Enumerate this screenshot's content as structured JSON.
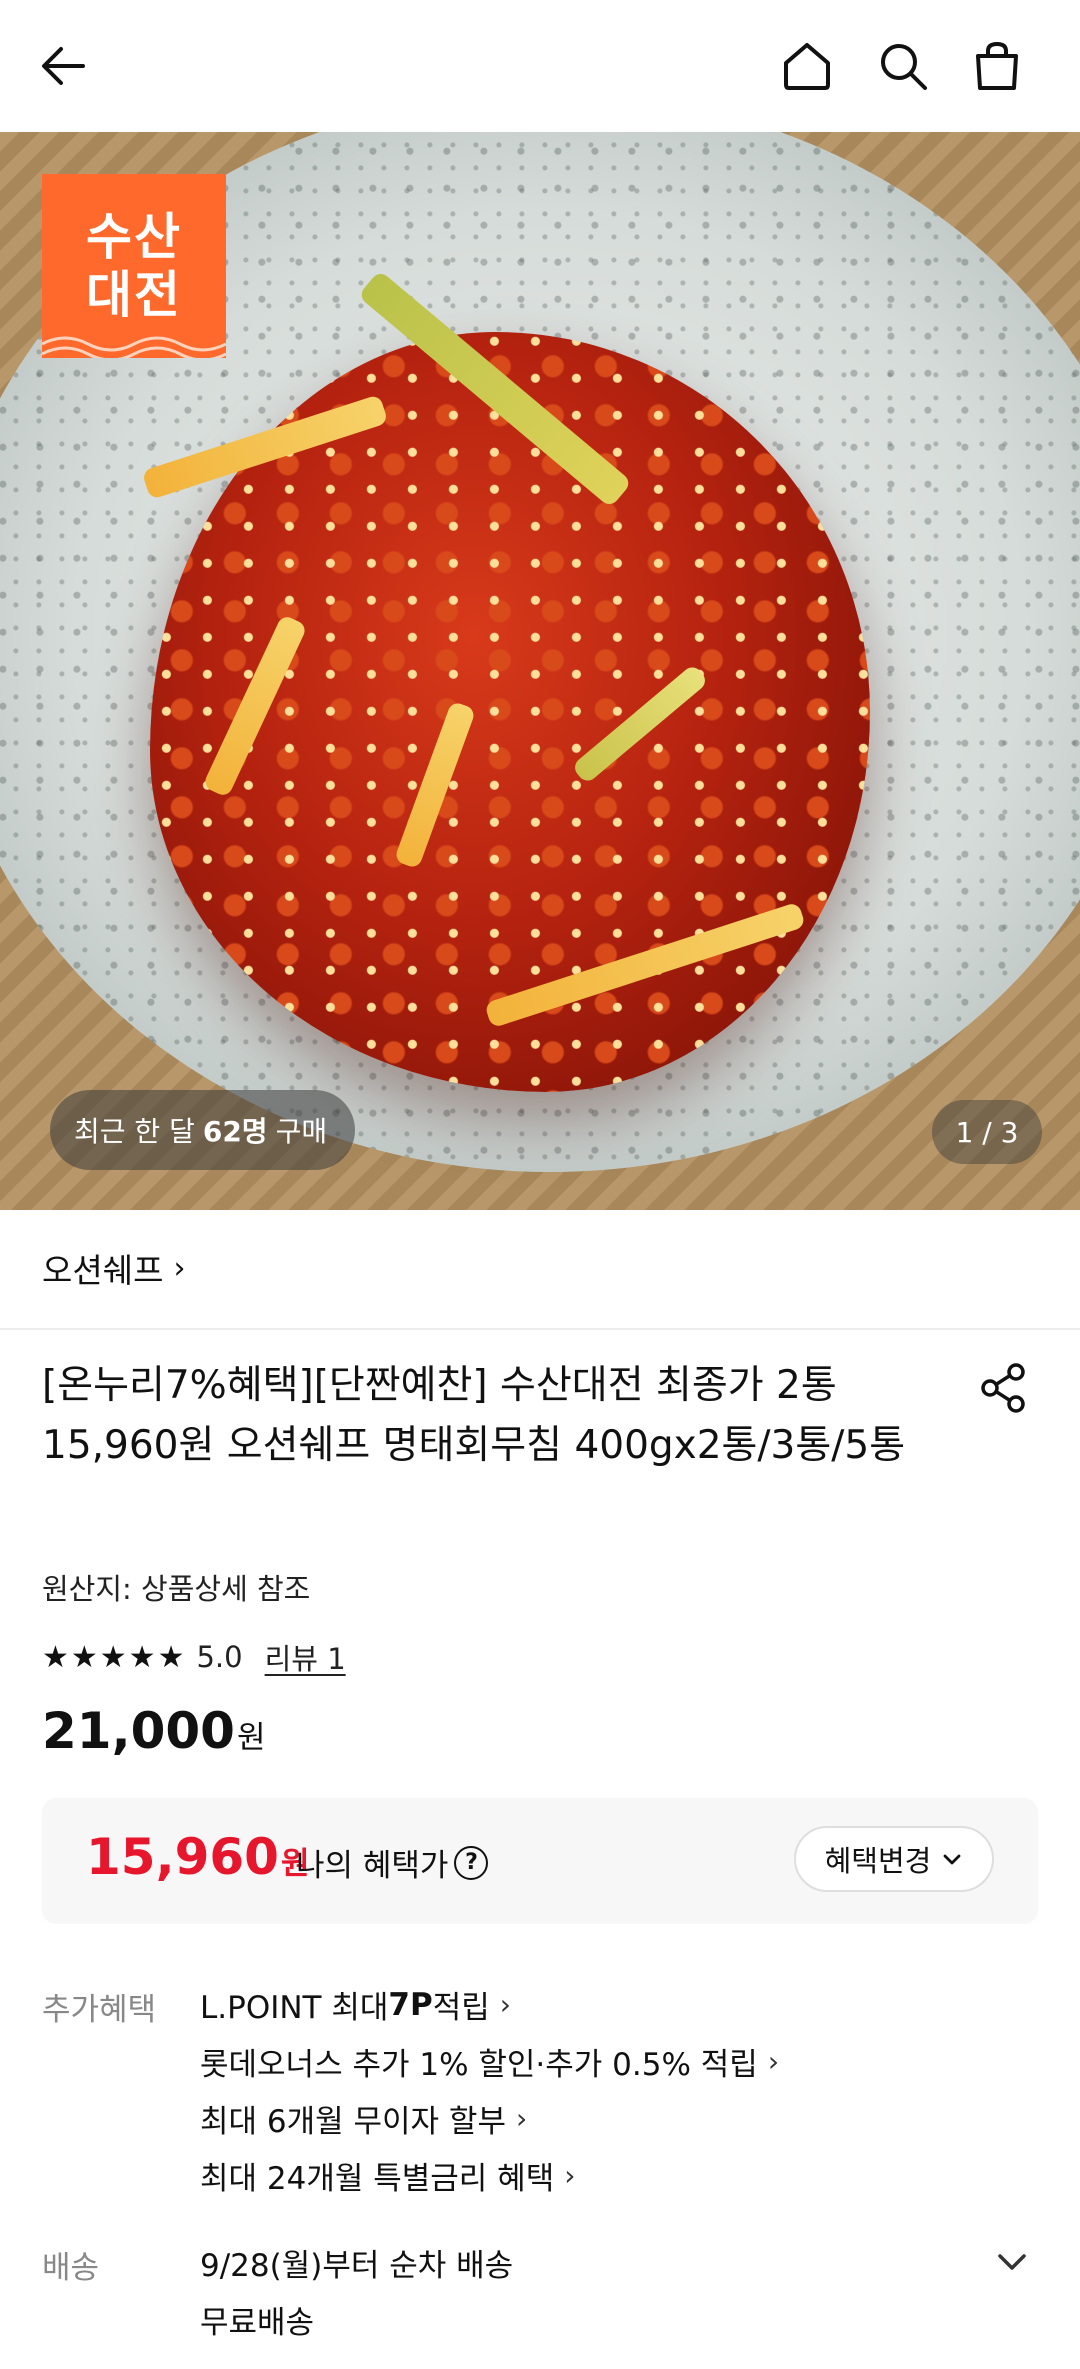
{
  "header": {
    "back_icon": "arrow-left-icon",
    "home_icon": "home-icon",
    "search_icon": "search-icon",
    "bag_icon": "shopping-bag-icon"
  },
  "hero": {
    "badge_line1": "수산",
    "badge_line2": "대전",
    "purchase_prefix": "최근 한 달",
    "purchase_count": "62명",
    "purchase_suffix": "구매",
    "image_counter": "1 / 3"
  },
  "seller": {
    "name": "오션쉐프",
    "chevron": "›"
  },
  "product": {
    "title": "[온누리7%혜택][단짠예찬] 수산대전 최종가 2통 15,960원 오션쉐프 명태회무침 400gx2통/3통/5통",
    "origin": "원산지: 상품상세 참조",
    "stars": "★★★★★",
    "rating": "5.0",
    "review_link": "리뷰 1",
    "price": "21,000",
    "price_unit": "원"
  },
  "benefit": {
    "price": "15,960",
    "price_unit": "원",
    "label": "나의 혜택가",
    "help_symbol": "?",
    "change_button": "혜택변경",
    "accent_color": "#e6162d"
  },
  "extra_benefits": {
    "label": "추가혜택",
    "items": [
      {
        "pre": "L.POINT 최대 ",
        "bold": "7P",
        "post": " 적립"
      },
      {
        "pre": "롯데오너스 추가 1% 할인·추가 0.5% 적립",
        "bold": "",
        "post": ""
      },
      {
        "pre": "최대 6개월 무이자 할부",
        "bold": "",
        "post": ""
      },
      {
        "pre": "최대 24개월 특별금리 혜택",
        "bold": "",
        "post": ""
      }
    ]
  },
  "shipping": {
    "label": "배송",
    "line1": "9/28(월)부터 순차 배송",
    "line2": "무료배송"
  }
}
